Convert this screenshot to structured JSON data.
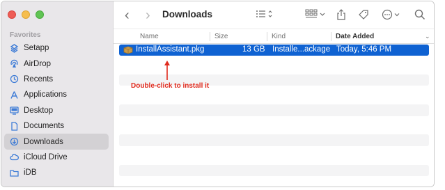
{
  "sidebar": {
    "heading": "Favorites",
    "items": [
      {
        "label": "Setapp",
        "icon": "setapp-icon"
      },
      {
        "label": "AirDrop",
        "icon": "airdrop-icon"
      },
      {
        "label": "Recents",
        "icon": "clock-icon"
      },
      {
        "label": "Applications",
        "icon": "applications-icon"
      },
      {
        "label": "Desktop",
        "icon": "desktop-icon"
      },
      {
        "label": "Documents",
        "icon": "document-icon"
      },
      {
        "label": "Downloads",
        "icon": "downloads-icon",
        "selected": true
      },
      {
        "label": "iCloud Drive",
        "icon": "cloud-icon"
      },
      {
        "label": "iDB",
        "icon": "folder-icon"
      }
    ]
  },
  "toolbar": {
    "title": "Downloads",
    "back": "‹",
    "forward": "›"
  },
  "columns": {
    "name": "Name",
    "size": "Size",
    "kind": "Kind",
    "date": "Date Added"
  },
  "file": {
    "name": "InstallAssistant.pkg",
    "size": "13 GB",
    "kind": "Installe...ackage",
    "date": "Today, 5:46 PM"
  },
  "annotation": "Double-click to install it",
  "colors": {
    "accent": "#0f62d2",
    "annotation": "#e02a1d"
  }
}
